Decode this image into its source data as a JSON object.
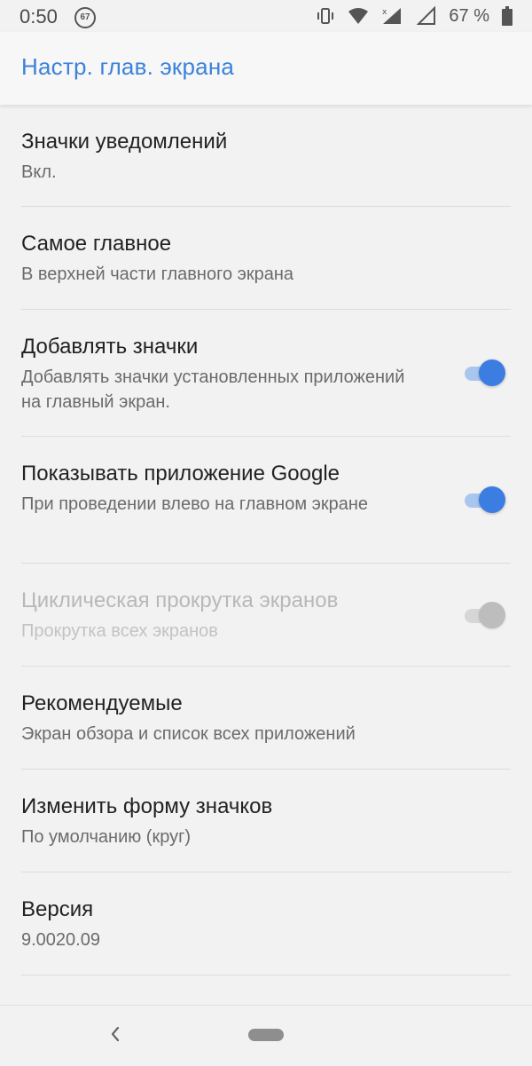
{
  "status_bar": {
    "time": "0:50",
    "notification_badge": "67",
    "battery_percent": "67 %",
    "icons": [
      "vibrate-icon",
      "wifi-icon",
      "signal-no-data-icon",
      "battery-icon"
    ]
  },
  "app_bar": {
    "title": "Настр. глав. экрана"
  },
  "colors": {
    "accent": "#3b82d9",
    "toggle_on": "#3b7de0",
    "toggle_off": "#bdbdbd"
  },
  "settings": [
    {
      "title": "Значки уведомлений",
      "summary": "Вкл."
    },
    {
      "title": "Самое главное",
      "summary": "В верхней части главного экрана"
    },
    {
      "title": "Добавлять значки",
      "summary": "Добавлять значки установленных приложений на главный экран.",
      "toggle": "on"
    },
    {
      "title": "Показывать приложение Google",
      "summary": "При проведении влево на главном экране",
      "toggle": "on"
    },
    {
      "title": "Циклическая прокрутка экранов",
      "summary": "Прокрутка всех экранов",
      "toggle": "off",
      "disabled": true
    },
    {
      "title": "Рекомендуемые",
      "summary": "Экран обзора и список всех приложений"
    },
    {
      "title": "Изменить форму значков",
      "summary": "По умолчанию (круг)"
    },
    {
      "title": "Версия",
      "summary": "9.0020.09"
    }
  ],
  "nav_bar": {
    "icons": [
      "back-icon",
      "home-pill-icon"
    ]
  }
}
